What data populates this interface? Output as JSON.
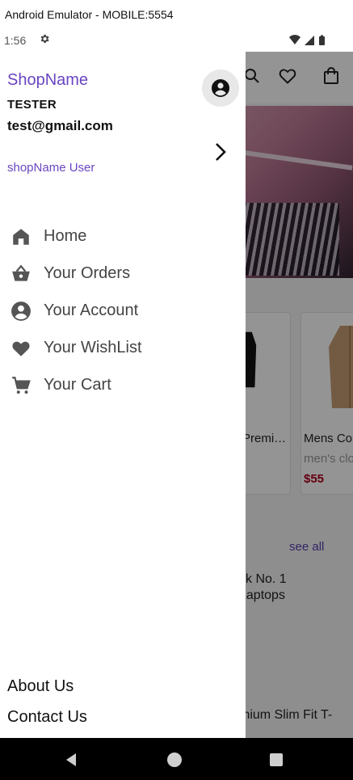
{
  "window": {
    "title": "Android Emulator - MOBILE:5554"
  },
  "status_bar": {
    "time": "1:56",
    "icons": [
      "gear-icon",
      "wifi-icon",
      "signal-icon",
      "battery-icon"
    ]
  },
  "background_app": {
    "toolbar_icons": [
      "search-icon",
      "heart-icon",
      "shopping-bag-icon"
    ],
    "products": [
      {
        "title": "Premi…",
        "subtitle": "",
        "price": ""
      },
      {
        "title": "Mens Co",
        "subtitle": "men's clo",
        "price": "$55"
      }
    ],
    "see_all_label": "see all",
    "text_line_1": "ck No. 1",
    "text_line_2": "Laptops",
    "text_line_3": "mium Slim Fit T-"
  },
  "drawer": {
    "shop_name": "ShopName",
    "user_name": "TESTER",
    "user_email": "test@gmail.com",
    "user_role": "shopName User",
    "menu": [
      {
        "icon": "home-icon",
        "label": "Home"
      },
      {
        "icon": "basket-icon",
        "label": "Your Orders"
      },
      {
        "icon": "account-icon",
        "label": "Your Account"
      },
      {
        "icon": "heart-icon",
        "label": "Your WishList"
      },
      {
        "icon": "cart-icon",
        "label": "Your Cart"
      }
    ],
    "footer": {
      "about_label": "About Us",
      "contact_label": "Contact Us"
    }
  },
  "colors": {
    "accent": "#6a45c0",
    "price": "#b0001c",
    "icon_gray": "#555555"
  }
}
